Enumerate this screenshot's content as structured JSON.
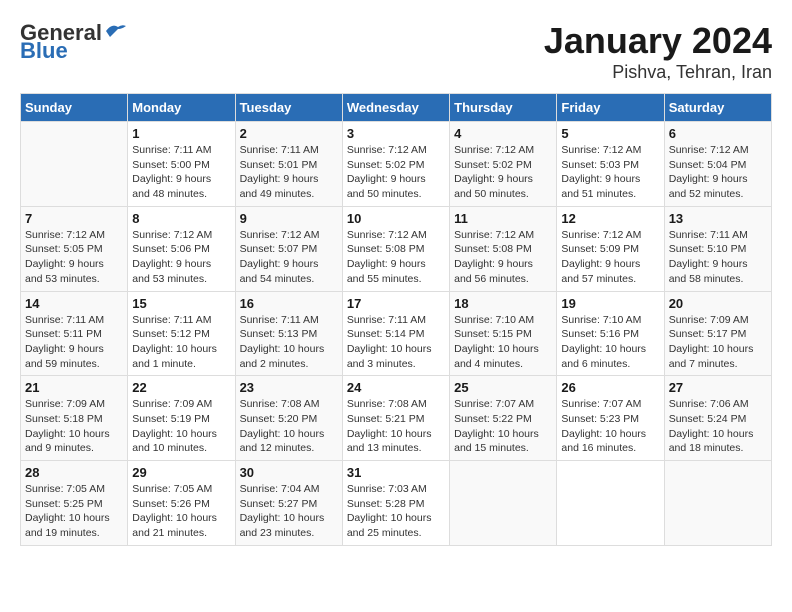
{
  "header": {
    "logo_line1": "General",
    "logo_line2": "Blue",
    "title": "January 2024",
    "subtitle": "Pishva, Tehran, Iran"
  },
  "calendar": {
    "headers": [
      "Sunday",
      "Monday",
      "Tuesday",
      "Wednesday",
      "Thursday",
      "Friday",
      "Saturday"
    ],
    "weeks": [
      [
        {
          "day": "",
          "info": ""
        },
        {
          "day": "1",
          "info": "Sunrise: 7:11 AM\nSunset: 5:00 PM\nDaylight: 9 hours\nand 48 minutes."
        },
        {
          "day": "2",
          "info": "Sunrise: 7:11 AM\nSunset: 5:01 PM\nDaylight: 9 hours\nand 49 minutes."
        },
        {
          "day": "3",
          "info": "Sunrise: 7:12 AM\nSunset: 5:02 PM\nDaylight: 9 hours\nand 50 minutes."
        },
        {
          "day": "4",
          "info": "Sunrise: 7:12 AM\nSunset: 5:02 PM\nDaylight: 9 hours\nand 50 minutes."
        },
        {
          "day": "5",
          "info": "Sunrise: 7:12 AM\nSunset: 5:03 PM\nDaylight: 9 hours\nand 51 minutes."
        },
        {
          "day": "6",
          "info": "Sunrise: 7:12 AM\nSunset: 5:04 PM\nDaylight: 9 hours\nand 52 minutes."
        }
      ],
      [
        {
          "day": "7",
          "info": "Sunrise: 7:12 AM\nSunset: 5:05 PM\nDaylight: 9 hours\nand 53 minutes."
        },
        {
          "day": "8",
          "info": "Sunrise: 7:12 AM\nSunset: 5:06 PM\nDaylight: 9 hours\nand 53 minutes."
        },
        {
          "day": "9",
          "info": "Sunrise: 7:12 AM\nSunset: 5:07 PM\nDaylight: 9 hours\nand 54 minutes."
        },
        {
          "day": "10",
          "info": "Sunrise: 7:12 AM\nSunset: 5:08 PM\nDaylight: 9 hours\nand 55 minutes."
        },
        {
          "day": "11",
          "info": "Sunrise: 7:12 AM\nSunset: 5:08 PM\nDaylight: 9 hours\nand 56 minutes."
        },
        {
          "day": "12",
          "info": "Sunrise: 7:12 AM\nSunset: 5:09 PM\nDaylight: 9 hours\nand 57 minutes."
        },
        {
          "day": "13",
          "info": "Sunrise: 7:11 AM\nSunset: 5:10 PM\nDaylight: 9 hours\nand 58 minutes."
        }
      ],
      [
        {
          "day": "14",
          "info": "Sunrise: 7:11 AM\nSunset: 5:11 PM\nDaylight: 9 hours\nand 59 minutes."
        },
        {
          "day": "15",
          "info": "Sunrise: 7:11 AM\nSunset: 5:12 PM\nDaylight: 10 hours\nand 1 minute."
        },
        {
          "day": "16",
          "info": "Sunrise: 7:11 AM\nSunset: 5:13 PM\nDaylight: 10 hours\nand 2 minutes."
        },
        {
          "day": "17",
          "info": "Sunrise: 7:11 AM\nSunset: 5:14 PM\nDaylight: 10 hours\nand 3 minutes."
        },
        {
          "day": "18",
          "info": "Sunrise: 7:10 AM\nSunset: 5:15 PM\nDaylight: 10 hours\nand 4 minutes."
        },
        {
          "day": "19",
          "info": "Sunrise: 7:10 AM\nSunset: 5:16 PM\nDaylight: 10 hours\nand 6 minutes."
        },
        {
          "day": "20",
          "info": "Sunrise: 7:09 AM\nSunset: 5:17 PM\nDaylight: 10 hours\nand 7 minutes."
        }
      ],
      [
        {
          "day": "21",
          "info": "Sunrise: 7:09 AM\nSunset: 5:18 PM\nDaylight: 10 hours\nand 9 minutes."
        },
        {
          "day": "22",
          "info": "Sunrise: 7:09 AM\nSunset: 5:19 PM\nDaylight: 10 hours\nand 10 minutes."
        },
        {
          "day": "23",
          "info": "Sunrise: 7:08 AM\nSunset: 5:20 PM\nDaylight: 10 hours\nand 12 minutes."
        },
        {
          "day": "24",
          "info": "Sunrise: 7:08 AM\nSunset: 5:21 PM\nDaylight: 10 hours\nand 13 minutes."
        },
        {
          "day": "25",
          "info": "Sunrise: 7:07 AM\nSunset: 5:22 PM\nDaylight: 10 hours\nand 15 minutes."
        },
        {
          "day": "26",
          "info": "Sunrise: 7:07 AM\nSunset: 5:23 PM\nDaylight: 10 hours\nand 16 minutes."
        },
        {
          "day": "27",
          "info": "Sunrise: 7:06 AM\nSunset: 5:24 PM\nDaylight: 10 hours\nand 18 minutes."
        }
      ],
      [
        {
          "day": "28",
          "info": "Sunrise: 7:05 AM\nSunset: 5:25 PM\nDaylight: 10 hours\nand 19 minutes."
        },
        {
          "day": "29",
          "info": "Sunrise: 7:05 AM\nSunset: 5:26 PM\nDaylight: 10 hours\nand 21 minutes."
        },
        {
          "day": "30",
          "info": "Sunrise: 7:04 AM\nSunset: 5:27 PM\nDaylight: 10 hours\nand 23 minutes."
        },
        {
          "day": "31",
          "info": "Sunrise: 7:03 AM\nSunset: 5:28 PM\nDaylight: 10 hours\nand 25 minutes."
        },
        {
          "day": "",
          "info": ""
        },
        {
          "day": "",
          "info": ""
        },
        {
          "day": "",
          "info": ""
        }
      ]
    ]
  }
}
